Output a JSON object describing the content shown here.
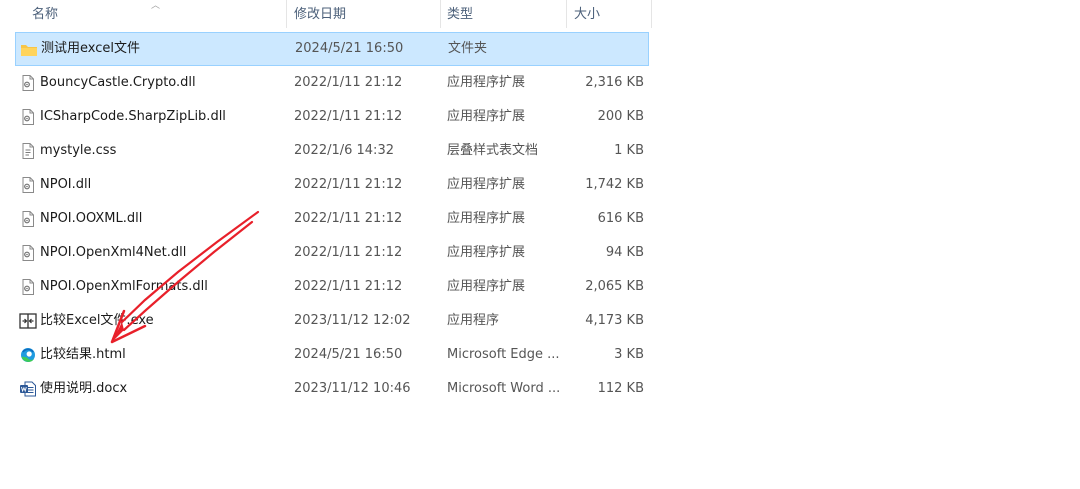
{
  "columns": {
    "name": "名称",
    "date": "修改日期",
    "type": "类型",
    "size": "大小"
  },
  "files": [
    {
      "name": "测试用excel文件",
      "date": "2024/5/21 16:50",
      "type": "文件夹",
      "size": "",
      "icon": "folder-icon",
      "selected": true
    },
    {
      "name": "BouncyCastle.Crypto.dll",
      "date": "2022/1/11 21:12",
      "type": "应用程序扩展",
      "size": "2,316 KB",
      "icon": "dll-file-icon",
      "selected": false
    },
    {
      "name": "ICSharpCode.SharpZipLib.dll",
      "date": "2022/1/11 21:12",
      "type": "应用程序扩展",
      "size": "200 KB",
      "icon": "dll-file-icon",
      "selected": false
    },
    {
      "name": "mystyle.css",
      "date": "2022/1/6 14:32",
      "type": "层叠样式表文档",
      "size": "1 KB",
      "icon": "css-file-icon",
      "selected": false
    },
    {
      "name": "NPOI.dll",
      "date": "2022/1/11 21:12",
      "type": "应用程序扩展",
      "size": "1,742 KB",
      "icon": "dll-file-icon",
      "selected": false
    },
    {
      "name": "NPOI.OOXML.dll",
      "date": "2022/1/11 21:12",
      "type": "应用程序扩展",
      "size": "616 KB",
      "icon": "dll-file-icon",
      "selected": false
    },
    {
      "name": "NPOI.OpenXml4Net.dll",
      "date": "2022/1/11 21:12",
      "type": "应用程序扩展",
      "size": "94 KB",
      "icon": "dll-file-icon",
      "selected": false
    },
    {
      "name": "NPOI.OpenXmlFormats.dll",
      "date": "2022/1/11 21:12",
      "type": "应用程序扩展",
      "size": "2,065 KB",
      "icon": "dll-file-icon",
      "selected": false
    },
    {
      "name": "比较Excel文件.exe",
      "date": "2023/11/12 12:02",
      "type": "应用程序",
      "size": "4,173 KB",
      "icon": "exe-app-icon",
      "selected": false
    },
    {
      "name": "比较结果.html",
      "date": "2024/5/21 16:50",
      "type": "Microsoft Edge ...",
      "size": "3 KB",
      "icon": "edge-icon",
      "selected": false
    },
    {
      "name": "使用说明.docx",
      "date": "2023/11/12 10:46",
      "type": "Microsoft Word ...",
      "size": "112 KB",
      "icon": "word-icon",
      "selected": false
    }
  ],
  "colors": {
    "selection": "#cce8ff",
    "selection_border": "#99d1ff",
    "annotation_arrow": "#e8202a"
  }
}
